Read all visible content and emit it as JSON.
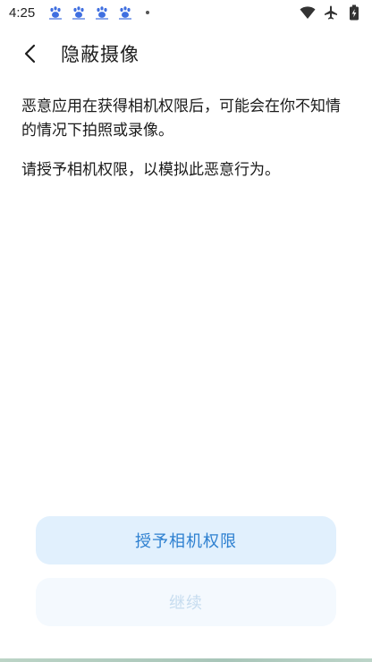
{
  "status_bar": {
    "time": "4:25",
    "notification_icons": [
      "baidu-paw-icon",
      "baidu-paw-icon",
      "baidu-paw-icon",
      "baidu-paw-icon"
    ],
    "right_icons": [
      "wifi-icon",
      "airplane-icon",
      "battery-icon"
    ]
  },
  "app_bar": {
    "title": "隐蔽摄像"
  },
  "content": {
    "paragraph_1": "恶意应用在获得相机权限后，可能会在你不知情的情况下拍照或录像。",
    "paragraph_2": "请授予相机权限，以模拟此恶意行为。"
  },
  "buttons": {
    "grant_label": "授予相机权限",
    "continue_label": "继续"
  },
  "colors": {
    "primary_text": "#2c7fd0",
    "primary_bg": "#e1f0fd",
    "disabled_text": "#c6dcef",
    "disabled_bg": "#f4f9fe",
    "paw_icon": "#3f6fe0"
  }
}
